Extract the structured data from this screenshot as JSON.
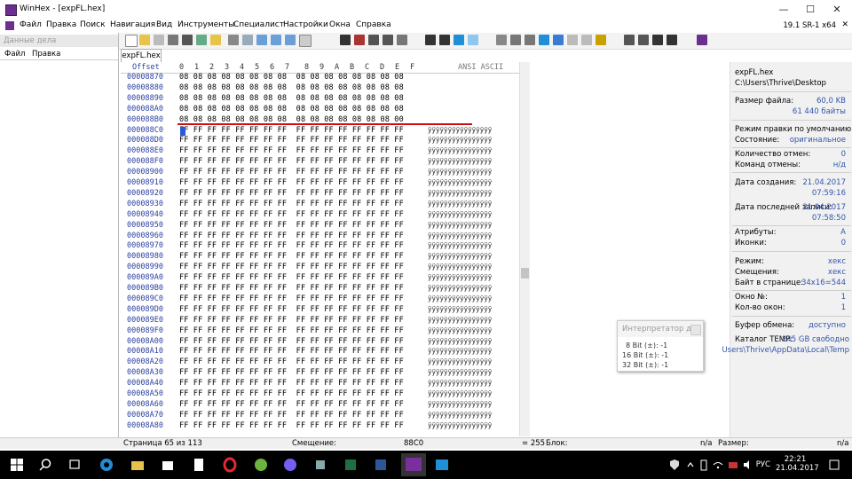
{
  "window": {
    "title": "WinHex - [expFL.hex]",
    "version": "19.1 SR-1 x64"
  },
  "menu": [
    "Файл",
    "Правка",
    "Поиск",
    "Навигация",
    "Вид",
    "Инструменты",
    "Специалист",
    "Настройки",
    "Окна",
    "Справка"
  ],
  "left_panel": {
    "header": "Данные дела",
    "submenu": [
      "Файл",
      "Правка"
    ]
  },
  "tab": "expFL.hex",
  "hex_header": {
    "offset": "Offset",
    "columns": [
      "0",
      "1",
      "2",
      "3",
      "4",
      "5",
      "6",
      "7",
      "8",
      "9",
      "A",
      "B",
      "C",
      "D",
      "E",
      "F"
    ],
    "ascii": "ANSI ASCII"
  },
  "rows": [
    {
      "offset": "00008870",
      "bytes": "08 08 08 08 08 08 08 08  08 08 08 08 08 08 08 08",
      "ascii": ""
    },
    {
      "offset": "00008880",
      "bytes": "08 08 08 08 08 08 08 08  08 08 08 08 08 08 08 08",
      "ascii": ""
    },
    {
      "offset": "00008890",
      "bytes": "08 08 08 08 08 08 08 08  08 08 08 08 08 08 08 08",
      "ascii": ""
    },
    {
      "offset": "000088A0",
      "bytes": "08 08 08 08 08 08 08 08  08 08 08 08 08 08 08 08",
      "ascii": ""
    },
    {
      "offset": "000088B0",
      "bytes": "08 08 08 08 08 08 08 08  08 08 08 08 08 08 08 00",
      "ascii": ""
    },
    {
      "offset": "000088C0",
      "bytes": "FF FF FF FF FF FF FF FF  FF FF FF FF FF FF FF FF",
      "ascii": "ÿÿÿÿÿÿÿÿÿÿÿÿÿÿÿÿ"
    },
    {
      "offset": "000088D0",
      "bytes": "FF FF FF FF FF FF FF FF  FF FF FF FF FF FF FF FF",
      "ascii": "ÿÿÿÿÿÿÿÿÿÿÿÿÿÿÿÿ"
    },
    {
      "offset": "000088E0",
      "bytes": "FF FF FF FF FF FF FF FF  FF FF FF FF FF FF FF FF",
      "ascii": "ÿÿÿÿÿÿÿÿÿÿÿÿÿÿÿÿ"
    },
    {
      "offset": "000088F0",
      "bytes": "FF FF FF FF FF FF FF FF  FF FF FF FF FF FF FF FF",
      "ascii": "ÿÿÿÿÿÿÿÿÿÿÿÿÿÿÿÿ"
    },
    {
      "offset": "00008900",
      "bytes": "FF FF FF FF FF FF FF FF  FF FF FF FF FF FF FF FF",
      "ascii": "ÿÿÿÿÿÿÿÿÿÿÿÿÿÿÿÿ"
    },
    {
      "offset": "00008910",
      "bytes": "FF FF FF FF FF FF FF FF  FF FF FF FF FF FF FF FF",
      "ascii": "ÿÿÿÿÿÿÿÿÿÿÿÿÿÿÿÿ"
    },
    {
      "offset": "00008920",
      "bytes": "FF FF FF FF FF FF FF FF  FF FF FF FF FF FF FF FF",
      "ascii": "ÿÿÿÿÿÿÿÿÿÿÿÿÿÿÿÿ"
    },
    {
      "offset": "00008930",
      "bytes": "FF FF FF FF FF FF FF FF  FF FF FF FF FF FF FF FF",
      "ascii": "ÿÿÿÿÿÿÿÿÿÿÿÿÿÿÿÿ"
    },
    {
      "offset": "00008940",
      "bytes": "FF FF FF FF FF FF FF FF  FF FF FF FF FF FF FF FF",
      "ascii": "ÿÿÿÿÿÿÿÿÿÿÿÿÿÿÿÿ"
    },
    {
      "offset": "00008950",
      "bytes": "FF FF FF FF FF FF FF FF  FF FF FF FF FF FF FF FF",
      "ascii": "ÿÿÿÿÿÿÿÿÿÿÿÿÿÿÿÿ"
    },
    {
      "offset": "00008960",
      "bytes": "FF FF FF FF FF FF FF FF  FF FF FF FF FF FF FF FF",
      "ascii": "ÿÿÿÿÿÿÿÿÿÿÿÿÿÿÿÿ"
    },
    {
      "offset": "00008970",
      "bytes": "FF FF FF FF FF FF FF FF  FF FF FF FF FF FF FF FF",
      "ascii": "ÿÿÿÿÿÿÿÿÿÿÿÿÿÿÿÿ"
    },
    {
      "offset": "00008980",
      "bytes": "FF FF FF FF FF FF FF FF  FF FF FF FF FF FF FF FF",
      "ascii": "ÿÿÿÿÿÿÿÿÿÿÿÿÿÿÿÿ"
    },
    {
      "offset": "00008990",
      "bytes": "FF FF FF FF FF FF FF FF  FF FF FF FF FF FF FF FF",
      "ascii": "ÿÿÿÿÿÿÿÿÿÿÿÿÿÿÿÿ"
    },
    {
      "offset": "000089A0",
      "bytes": "FF FF FF FF FF FF FF FF  FF FF FF FF FF FF FF FF",
      "ascii": "ÿÿÿÿÿÿÿÿÿÿÿÿÿÿÿÿ"
    },
    {
      "offset": "000089B0",
      "bytes": "FF FF FF FF FF FF FF FF  FF FF FF FF FF FF FF FF",
      "ascii": "ÿÿÿÿÿÿÿÿÿÿÿÿÿÿÿÿ"
    },
    {
      "offset": "000089C0",
      "bytes": "FF FF FF FF FF FF FF FF  FF FF FF FF FF FF FF FF",
      "ascii": "ÿÿÿÿÿÿÿÿÿÿÿÿÿÿÿÿ"
    },
    {
      "offset": "000089D0",
      "bytes": "FF FF FF FF FF FF FF FF  FF FF FF FF FF FF FF FF",
      "ascii": "ÿÿÿÿÿÿÿÿÿÿÿÿÿÿÿÿ"
    },
    {
      "offset": "000089E0",
      "bytes": "FF FF FF FF FF FF FF FF  FF FF FF FF FF FF FF FF",
      "ascii": "ÿÿÿÿÿÿÿÿÿÿÿÿÿÿÿÿ"
    },
    {
      "offset": "000089F0",
      "bytes": "FF FF FF FF FF FF FF FF  FF FF FF FF FF FF FF FF",
      "ascii": "ÿÿÿÿÿÿÿÿÿÿÿÿÿÿÿÿ"
    },
    {
      "offset": "00008A00",
      "bytes": "FF FF FF FF FF FF FF FF  FF FF FF FF FF FF FF FF",
      "ascii": "ÿÿÿÿÿÿÿÿÿÿÿÿÿÿÿÿ"
    },
    {
      "offset": "00008A10",
      "bytes": "FF FF FF FF FF FF FF FF  FF FF FF FF FF FF FF FF",
      "ascii": "ÿÿÿÿÿÿÿÿÿÿÿÿÿÿÿÿ"
    },
    {
      "offset": "00008A20",
      "bytes": "FF FF FF FF FF FF FF FF  FF FF FF FF FF FF FF FF",
      "ascii": "ÿÿÿÿÿÿÿÿÿÿÿÿÿÿÿÿ"
    },
    {
      "offset": "00008A30",
      "bytes": "FF FF FF FF FF FF FF FF  FF FF FF FF FF FF FF FF",
      "ascii": "ÿÿÿÿÿÿÿÿÿÿÿÿÿÿÿÿ"
    },
    {
      "offset": "00008A40",
      "bytes": "FF FF FF FF FF FF FF FF  FF FF FF FF FF FF FF FF",
      "ascii": "ÿÿÿÿÿÿÿÿÿÿÿÿÿÿÿÿ"
    },
    {
      "offset": "00008A50",
      "bytes": "FF FF FF FF FF FF FF FF  FF FF FF FF FF FF FF FF",
      "ascii": "ÿÿÿÿÿÿÿÿÿÿÿÿÿÿÿÿ"
    },
    {
      "offset": "00008A60",
      "bytes": "FF FF FF FF FF FF FF FF  FF FF FF FF FF FF FF FF",
      "ascii": "ÿÿÿÿÿÿÿÿÿÿÿÿÿÿÿÿ"
    },
    {
      "offset": "00008A70",
      "bytes": "FF FF FF FF FF FF FF FF  FF FF FF FF FF FF FF FF",
      "ascii": "ÿÿÿÿÿÿÿÿÿÿÿÿÿÿÿÿ"
    },
    {
      "offset": "00008A80",
      "bytes": "FF FF FF FF FF FF FF FF  FF FF FF FF FF FF FF FF",
      "ascii": "ÿÿÿÿÿÿÿÿÿÿÿÿÿÿÿÿ"
    }
  ],
  "info": {
    "filename": "expFL.hex",
    "path": "C:\\Users\\Thrive\\Desktop",
    "size_label": "Размер файла:",
    "size_kb": "60,0 KB",
    "size_bytes": "61 440 байты",
    "edit_mode": "Режим правки по умолчанию",
    "state_label": "Состояние:",
    "state_value": "оригинальное",
    "undo_label": "Количество отмен:",
    "undo_value": "0",
    "undo_cmd_label": "Команд отмены:",
    "undo_cmd_value": "н/д",
    "created_label": "Дата создания:",
    "created_date": "21.04.2017",
    "created_time": "07:59:16",
    "modified_label": "Дата последней записи:",
    "modified_date": "21.04.2017",
    "modified_time": "07:58:50",
    "attr_label": "Атрибуты:",
    "attr_value": "A",
    "icons_label": "Иконки:",
    "icons_value": "0",
    "mode_label": "Режим:",
    "mode_value": "хекс",
    "offsets_label": "Смещения:",
    "offsets_value": "хекс",
    "bytes_per_page_label": "Байт в странице:",
    "bytes_per_page_value": "34x16=544",
    "window_no_label": "Окно №:",
    "window_no_value": "1",
    "windows_count_label": "Кол-во окон:",
    "windows_count_value": "1",
    "clipboard_label": "Буфер обмена:",
    "clipboard_value": "доступно",
    "temp_label": "Каталог TEMP:",
    "temp_free": "245 GB свободно",
    "temp_path": "Users\\Thrive\\AppData\\Local\\Temp"
  },
  "interpreter": {
    "title": "Интерпретатор д...",
    "lines": [
      "8 Bit (±): -1",
      "16 Bit (±): -1",
      "32 Bit (±): -1"
    ]
  },
  "status": {
    "page": "Страница 65 из 113",
    "offset_label": "Смещение:",
    "offset_value": "88C0",
    "eq": "= 255",
    "block_label": "Блок:",
    "block_value": "n/a",
    "size_label": "Размер:",
    "size_value": "n/a"
  },
  "taskbar": {
    "lang": "РУС",
    "time": "22:21",
    "date": "21.04.2017"
  },
  "colors": {
    "accent_blue": "#2a3fa0",
    "red_marker": "#d01010",
    "info_value": "#3355aa"
  }
}
